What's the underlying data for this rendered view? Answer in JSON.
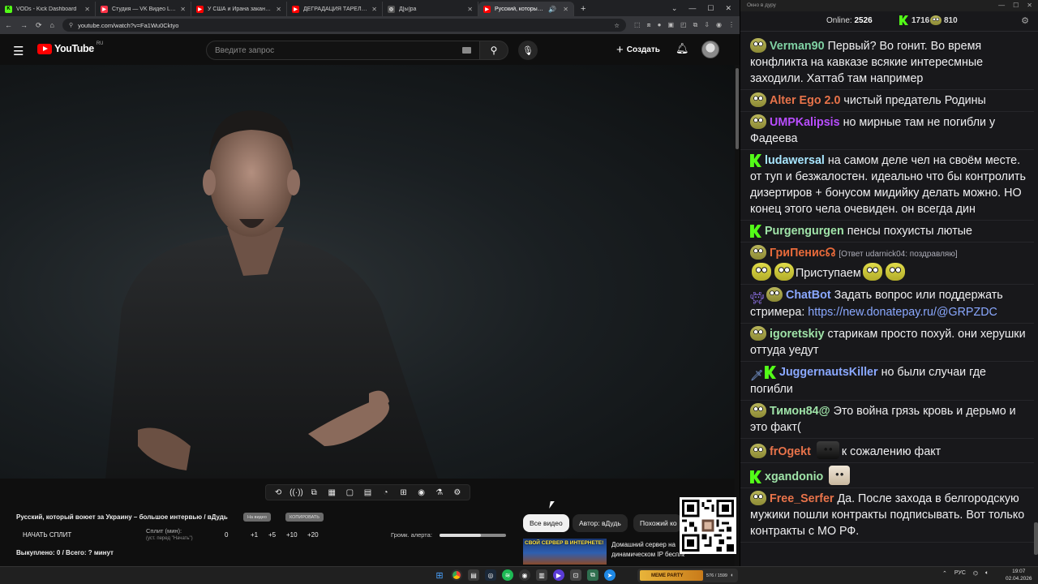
{
  "browser": {
    "tabs": [
      {
        "title": "VODs - Kick Dashboard",
        "favicon_color": "#53fc18",
        "favicon_glyph": "K"
      },
      {
        "title": "Студия — VK Видео Live",
        "favicon_color": "#ff3347",
        "favicon_glyph": "▶"
      },
      {
        "title": "У США и Ирана заканчиваются",
        "favicon_color": "#ff0000",
        "favicon_glyph": "▶"
      },
      {
        "title": "ДЕГРАДАЦИЯ ТАРЕЛОЧНИЦ",
        "favicon_color": "#ff0000",
        "favicon_glyph": "▶"
      },
      {
        "title": "Д[ы]ра",
        "favicon_color": "#555555",
        "favicon_glyph": "◎"
      },
      {
        "title": "Русский, который воюет з",
        "favicon_color": "#ff0000",
        "favicon_glyph": "▶"
      }
    ],
    "new_tab": "+",
    "window_controls": [
      "⌄",
      "—",
      "☐",
      "✕"
    ],
    "nav": [
      "←",
      "→",
      "⟳",
      "⌂"
    ],
    "url": "youtube.com/watch?v=Fa1Wu0Cktyo"
  },
  "youtube": {
    "logo_text": "YouTube",
    "logo_region": "RU",
    "search_placeholder": "Введите запрос",
    "create_label": "Создать"
  },
  "player_tools": [
    "⟲",
    "((·))",
    "⧉",
    "▦",
    "▢",
    "▤",
    "◔",
    "⊞",
    "◉",
    "⚗",
    "⚙"
  ],
  "split_panel": {
    "video_title": "Русский, который воюет за Украину – большое интервью / вДудь",
    "pill_1": "На видео",
    "pill_2": "КОПИРОВАТЬ",
    "start_split": "НАЧАТЬ СПЛИТ",
    "split_label": "Сплит (мин):",
    "split_sub": "(уст. перед \"Начать\")",
    "split_values": [
      "0",
      "+1",
      "+5",
      "+10",
      "+20"
    ],
    "alert_label": "Громк. алерта:",
    "alert_volume": 0.62,
    "bought": "Выкуплено: 0 / Всего: ? минут"
  },
  "filters": {
    "all": "Все видео",
    "author": "Автор: вДудь",
    "similar": "Похожий ко"
  },
  "recommendation": {
    "thumb_text": "СВОЙ СЕРВЕР В ИНТЕРНЕТЕ!",
    "title_line1": "Домашний сервер на",
    "title_line2": "динамическом IP бесплатно!"
  },
  "chat": {
    "window_title": "Окно в дуру",
    "online_label": "Online:",
    "online_count": "2526",
    "kick_count": "1716",
    "pepe_count": "810",
    "messages": [
      {
        "user": "Verman90",
        "color": "#7fd1a3",
        "badges": [
          "pepe"
        ],
        "text": "Первый? Во гонит. Во время конфликта на кавказе всякие интересмные заходили. Хаттаб там например"
      },
      {
        "user": "Alter Ego 2.0",
        "color": "#e8734a",
        "badges": [
          "pepe"
        ],
        "text": "чистый предатель Родины"
      },
      {
        "user": "UMPKalipsis",
        "color": "#b84dff",
        "badges": [
          "pepe"
        ],
        "text": "но мирные там не погибли у Фадеева"
      },
      {
        "user": "ludawersal",
        "color": "#a8e6ff",
        "badges": [
          "k"
        ],
        "text": "на самом деле чел на своём месте. от туп и безжалостен. идеально что бы контролить дизертиров + бонусом мидийку делать можно. НО конец этого чела очевиден. он всегда дин"
      },
      {
        "user": "Purgengurgen",
        "color": "#9fe3a8",
        "badges": [
          "k"
        ],
        "text": "пенсы похуисты лютые"
      },
      {
        "user": "ГриПенис☊",
        "color": "#e86a3a",
        "badges": [
          "pepe"
        ],
        "reply": "[Ответ udarnick04: поздравляю]",
        "text": "Приступаем"
      },
      {
        "user": "ChatBot",
        "color": "#8aa8ff",
        "badges": [
          "bot",
          "pepe"
        ],
        "text": "Задать вопрос или поддержать стримера:",
        "link": "https://new.donatepay.ru/@GRPZDC"
      },
      {
        "user": "igoretskiy",
        "color": "#9fe3a8",
        "badges": [
          "pepe"
        ],
        "text": "старикам просто похуй. они херушки оттуда уедут"
      },
      {
        "user": "JuggernautsKiller",
        "color": "#8aa8ff",
        "badges": [
          "sword",
          "k"
        ],
        "text": "но были случаи где погибли"
      },
      {
        "user": "Тимон84@",
        "color": "#9fe3a8",
        "badges": [
          "pepe"
        ],
        "text": "Это война грязь кровь и дерьмо и это факт("
      },
      {
        "user": "frOgekt",
        "color": "#e8734a",
        "badges": [
          "pepe"
        ],
        "text": "к сожалению факт"
      },
      {
        "user": "xgandonio",
        "color": "#9fe3a8",
        "badges": [
          "k"
        ],
        "text": ""
      },
      {
        "user": "Free_Serfer",
        "color": "#e8734a",
        "badges": [
          "pepe"
        ],
        "text": "Да. После захода в белгородскую мужики пошли контракты подписывать. Вот только контракты с МО РФ."
      }
    ]
  },
  "taskbar": {
    "app_label": "MEME PARTY",
    "app_counter": "576 / 1599",
    "lang": "РУС",
    "time": "19:07",
    "date": "02.04.2026"
  },
  "colors": {
    "youtube_red": "#ff0000",
    "kick_green": "#53fc18",
    "chat_bg": "#18181b"
  }
}
